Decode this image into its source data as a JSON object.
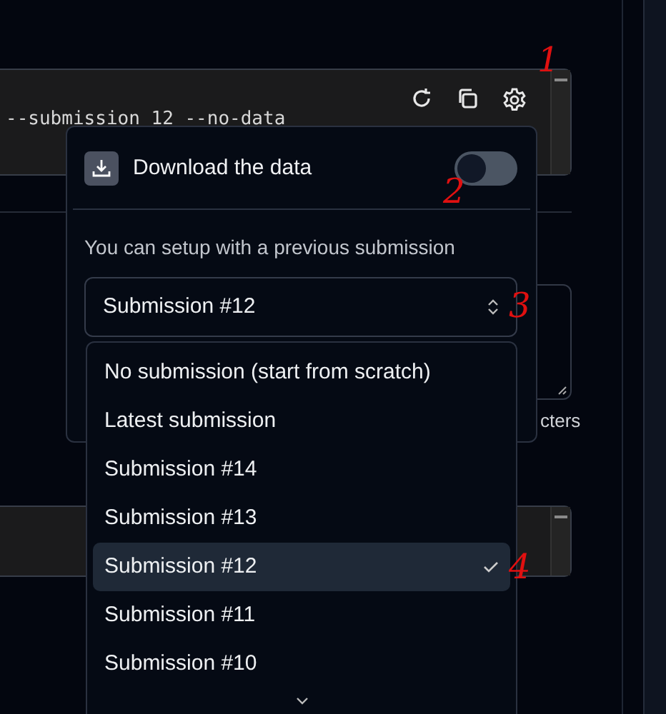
{
  "code_block": {
    "text": "--submission 12 --no-data"
  },
  "popover": {
    "download": {
      "label": "Download the data",
      "on": false
    },
    "hint": "You can setup with a previous submission",
    "select": {
      "value": "Submission #12"
    }
  },
  "options": [
    {
      "label": "No submission (start from scratch)",
      "selected": false
    },
    {
      "label": "Latest submission",
      "selected": false
    },
    {
      "label": "Submission #14",
      "selected": false
    },
    {
      "label": "Submission #13",
      "selected": false
    },
    {
      "label": "Submission #12",
      "selected": true
    },
    {
      "label": "Submission #11",
      "selected": false
    },
    {
      "label": "Submission #10",
      "selected": false
    }
  ],
  "background_text": "cters",
  "annotations": [
    {
      "label": "1"
    },
    {
      "label": "2"
    },
    {
      "label": "3"
    },
    {
      "label": "4"
    }
  ]
}
